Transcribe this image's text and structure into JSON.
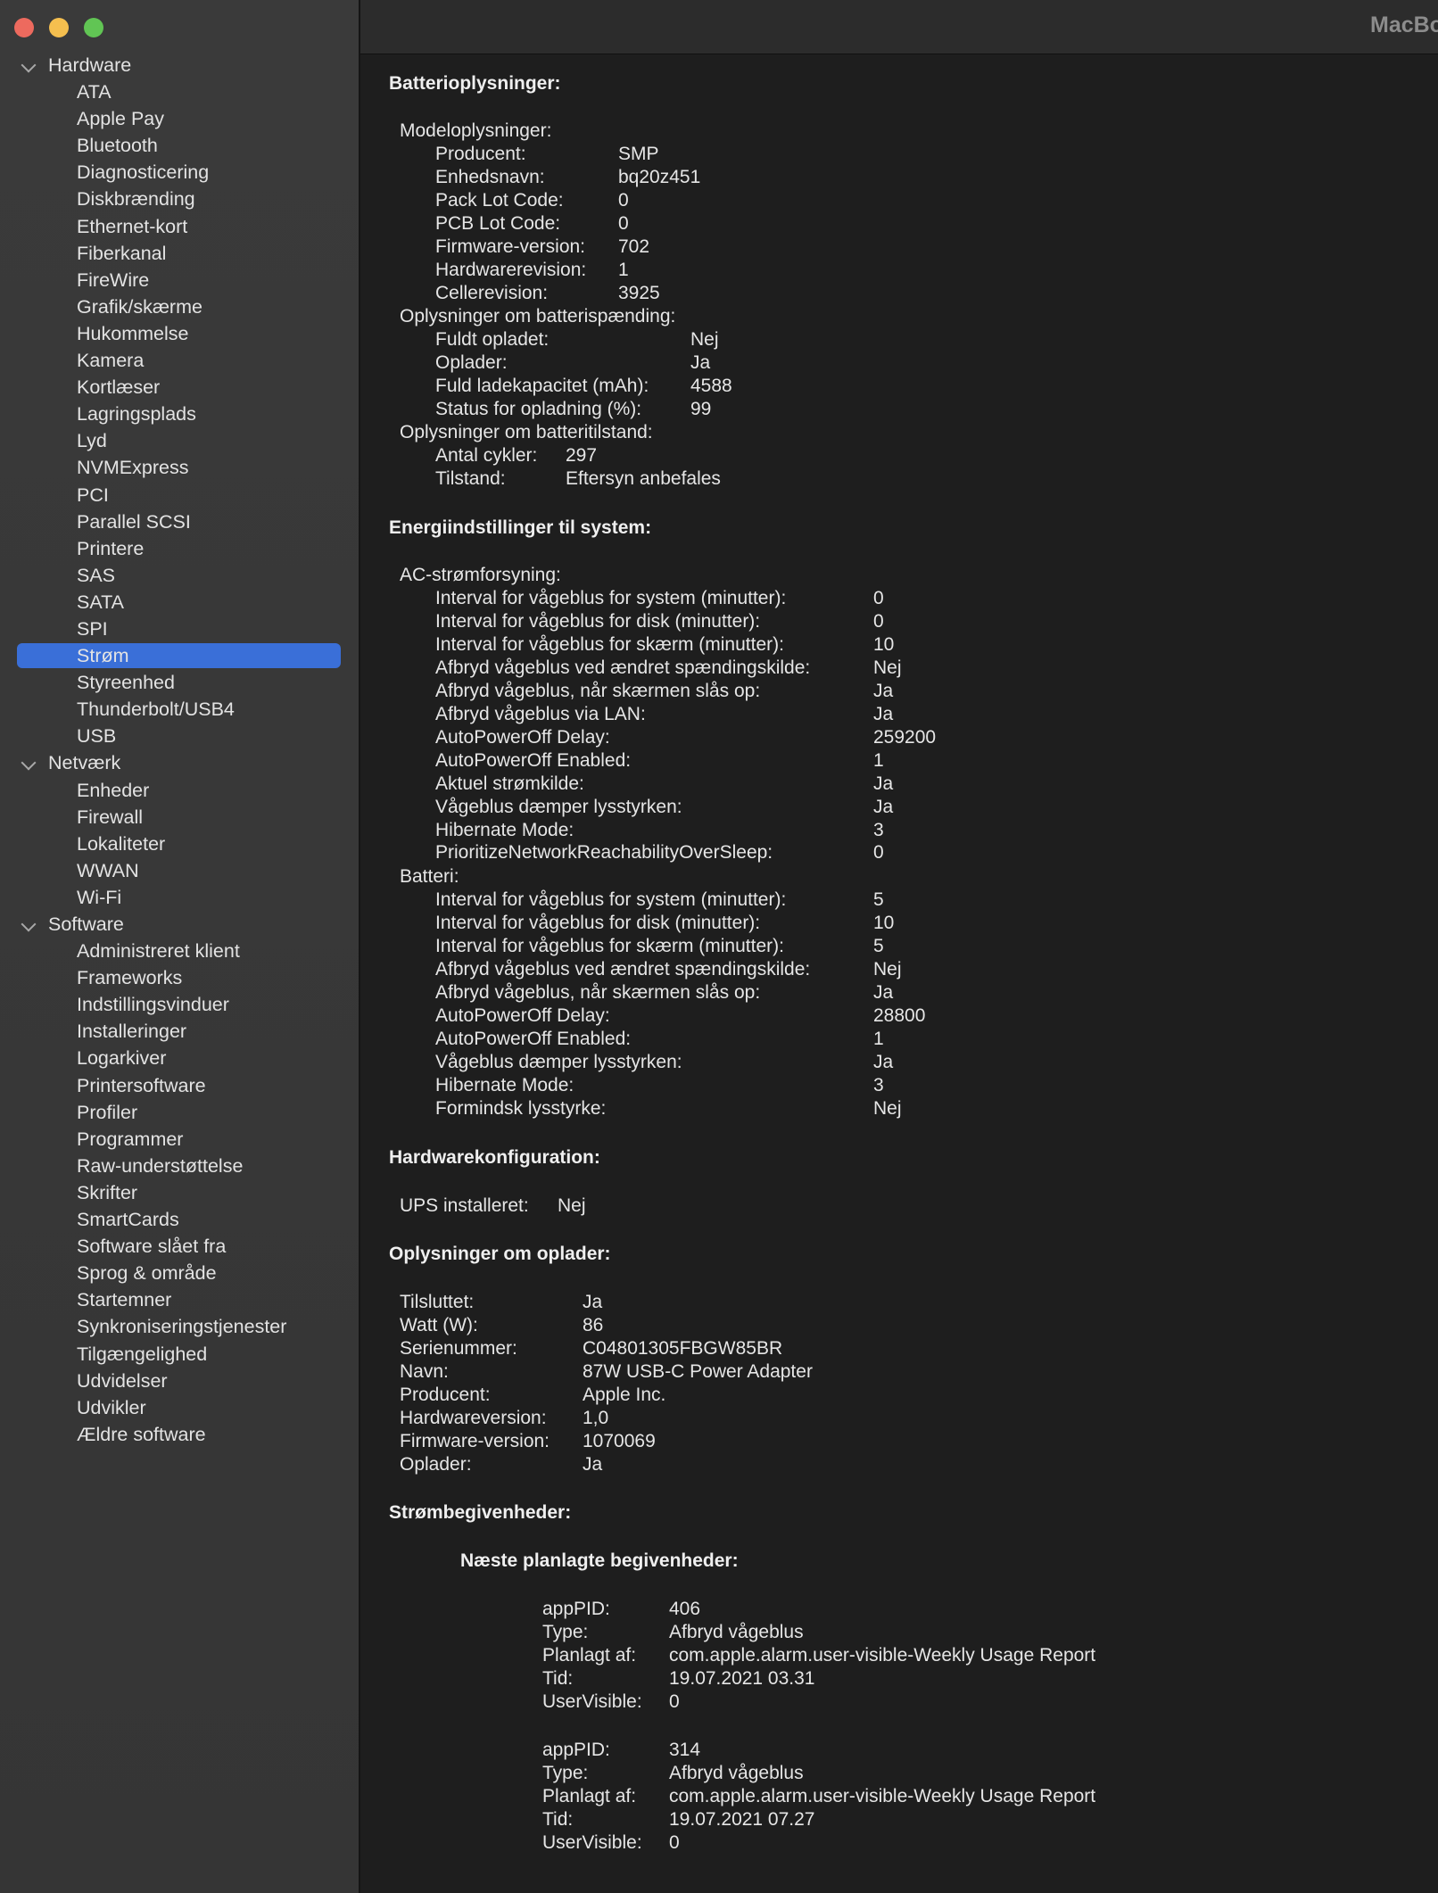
{
  "window": {
    "title": "MacBo"
  },
  "sidebar": {
    "items": [
      {
        "label": "Hardware",
        "type": "group"
      },
      {
        "label": "ATA",
        "type": "leaf"
      },
      {
        "label": "Apple Pay",
        "type": "leaf"
      },
      {
        "label": "Bluetooth",
        "type": "leaf"
      },
      {
        "label": "Diagnosticering",
        "type": "leaf"
      },
      {
        "label": "Diskbrænding",
        "type": "leaf"
      },
      {
        "label": "Ethernet-kort",
        "type": "leaf"
      },
      {
        "label": "Fiberkanal",
        "type": "leaf"
      },
      {
        "label": "FireWire",
        "type": "leaf"
      },
      {
        "label": "Grafik/skærme",
        "type": "leaf"
      },
      {
        "label": "Hukommelse",
        "type": "leaf"
      },
      {
        "label": "Kamera",
        "type": "leaf"
      },
      {
        "label": "Kortlæser",
        "type": "leaf"
      },
      {
        "label": "Lagringsplads",
        "type": "leaf"
      },
      {
        "label": "Lyd",
        "type": "leaf"
      },
      {
        "label": "NVMExpress",
        "type": "leaf"
      },
      {
        "label": "PCI",
        "type": "leaf"
      },
      {
        "label": "Parallel SCSI",
        "type": "leaf"
      },
      {
        "label": "Printere",
        "type": "leaf"
      },
      {
        "label": "SAS",
        "type": "leaf"
      },
      {
        "label": "SATA",
        "type": "leaf"
      },
      {
        "label": "SPI",
        "type": "leaf"
      },
      {
        "label": "Strøm",
        "type": "leaf",
        "selected": true
      },
      {
        "label": "Styreenhed",
        "type": "leaf"
      },
      {
        "label": "Thunderbolt/USB4",
        "type": "leaf"
      },
      {
        "label": "USB",
        "type": "leaf"
      },
      {
        "label": "Netværk",
        "type": "group"
      },
      {
        "label": "Enheder",
        "type": "leaf"
      },
      {
        "label": "Firewall",
        "type": "leaf"
      },
      {
        "label": "Lokaliteter",
        "type": "leaf"
      },
      {
        "label": "WWAN",
        "type": "leaf"
      },
      {
        "label": "Wi-Fi",
        "type": "leaf"
      },
      {
        "label": "Software",
        "type": "group"
      },
      {
        "label": "Administreret klient",
        "type": "leaf"
      },
      {
        "label": "Frameworks",
        "type": "leaf"
      },
      {
        "label": "Indstillingsvinduer",
        "type": "leaf"
      },
      {
        "label": "Installeringer",
        "type": "leaf"
      },
      {
        "label": "Logarkiver",
        "type": "leaf"
      },
      {
        "label": "Printersoftware",
        "type": "leaf"
      },
      {
        "label": "Profiler",
        "type": "leaf"
      },
      {
        "label": "Programmer",
        "type": "leaf"
      },
      {
        "label": "Raw-understøttelse",
        "type": "leaf"
      },
      {
        "label": "Skrifter",
        "type": "leaf"
      },
      {
        "label": "SmartCards",
        "type": "leaf"
      },
      {
        "label": "Software slået fra",
        "type": "leaf"
      },
      {
        "label": "Sprog & område",
        "type": "leaf"
      },
      {
        "label": "Startemner",
        "type": "leaf"
      },
      {
        "label": "Synkroniseringstjenester",
        "type": "leaf"
      },
      {
        "label": "Tilgængelighed",
        "type": "leaf"
      },
      {
        "label": "Udvidelser",
        "type": "leaf"
      },
      {
        "label": "Udvikler",
        "type": "leaf"
      },
      {
        "label": "Ældre software",
        "type": "leaf"
      }
    ]
  },
  "battery": {
    "heading": "Batterioplysninger:",
    "model_heading": "Modeloplysninger:",
    "model": [
      {
        "k": "Producent:",
        "v": "SMP"
      },
      {
        "k": "Enhedsnavn:",
        "v": "bq20z451"
      },
      {
        "k": "Pack Lot Code:",
        "v": "0"
      },
      {
        "k": "PCB Lot Code:",
        "v": "0"
      },
      {
        "k": "Firmware-version:",
        "v": "702"
      },
      {
        "k": "Hardwarerevision:",
        "v": "1"
      },
      {
        "k": "Cellerevision:",
        "v": "3925"
      }
    ],
    "charge_heading": "Oplysninger om batterispænding:",
    "charge": [
      {
        "k": "Fuldt opladet:",
        "v": "Nej"
      },
      {
        "k": "Oplader:",
        "v": "Ja"
      },
      {
        "k": "Fuld ladekapacitet (mAh):",
        "v": "4588"
      },
      {
        "k": "Status for opladning (%):",
        "v": "99"
      }
    ],
    "health_heading": "Oplysninger om batteritilstand:",
    "health": [
      {
        "k": "Antal cykler:",
        "v": "297"
      },
      {
        "k": "Tilstand:",
        "v": "Eftersyn anbefales"
      }
    ]
  },
  "energy": {
    "heading": "Energiindstillinger til system:",
    "ac_heading": "AC-strømforsyning:",
    "ac": [
      {
        "k": "Interval for vågeblus for system (minutter):",
        "v": "0"
      },
      {
        "k": "Interval for vågeblus for disk (minutter):",
        "v": "0"
      },
      {
        "k": "Interval for vågeblus for skærm (minutter):",
        "v": "10"
      },
      {
        "k": "Afbryd vågeblus ved ændret spændingskilde:",
        "v": "Nej"
      },
      {
        "k": "Afbryd vågeblus, når skærmen slås op:",
        "v": "Ja"
      },
      {
        "k": "Afbryd vågeblus via LAN:",
        "v": "Ja"
      },
      {
        "k": "AutoPowerOff Delay:",
        "v": "259200"
      },
      {
        "k": "AutoPowerOff Enabled:",
        "v": "1"
      },
      {
        "k": "Aktuel strømkilde:",
        "v": "Ja"
      },
      {
        "k": "Vågeblus dæmper lysstyrken:",
        "v": "Ja"
      },
      {
        "k": "Hibernate Mode:",
        "v": "3"
      },
      {
        "k": "PrioritizeNetworkReachabilityOverSleep:",
        "v": "0"
      }
    ],
    "bat_heading": "Batteri:",
    "bat": [
      {
        "k": "Interval for vågeblus for system (minutter):",
        "v": "5"
      },
      {
        "k": "Interval for vågeblus for disk (minutter):",
        "v": "10"
      },
      {
        "k": "Interval for vågeblus for skærm (minutter):",
        "v": "5"
      },
      {
        "k": "Afbryd vågeblus ved ændret spændingskilde:",
        "v": "Nej"
      },
      {
        "k": "Afbryd vågeblus, når skærmen slås op:",
        "v": "Ja"
      },
      {
        "k": "AutoPowerOff Delay:",
        "v": "28800"
      },
      {
        "k": "AutoPowerOff Enabled:",
        "v": "1"
      },
      {
        "k": "Vågeblus dæmper lysstyrken:",
        "v": "Ja"
      },
      {
        "k": "Hibernate Mode:",
        "v": "3"
      },
      {
        "k": "Formindsk lysstyrke:",
        "v": "Nej"
      }
    ]
  },
  "hwconfig": {
    "heading": "Hardwarekonfiguration:",
    "rows": [
      {
        "k": "UPS installeret:",
        "v": "Nej"
      }
    ]
  },
  "charger": {
    "heading": "Oplysninger om oplader:",
    "rows": [
      {
        "k": "Tilsluttet:",
        "v": "Ja"
      },
      {
        "k": "Watt (W):",
        "v": "86"
      },
      {
        "k": "Serienummer:",
        "v": "C04801305FBGW85BR"
      },
      {
        "k": "Navn:",
        "v": "87W USB-C Power Adapter"
      },
      {
        "k": "Producent:",
        "v": "Apple Inc."
      },
      {
        "k": "Hardwareversion:",
        "v": "1,0"
      },
      {
        "k": "Firmware-version:",
        "v": "1070069"
      },
      {
        "k": "Oplader:",
        "v": "Ja"
      }
    ]
  },
  "events": {
    "heading": "Strømbegivenheder:",
    "sub_heading": "Næste planlagte begivenheder:",
    "items": [
      [
        {
          "k": "appPID:",
          "v": "406"
        },
        {
          "k": "Type:",
          "v": "Afbryd vågeblus"
        },
        {
          "k": "Planlagt af:",
          "v": "com.apple.alarm.user-visible-Weekly Usage Report"
        },
        {
          "k": "Tid:",
          "v": "19.07.2021 03.31"
        },
        {
          "k": "UserVisible:",
          "v": "0"
        }
      ],
      [
        {
          "k": "appPID:",
          "v": "314"
        },
        {
          "k": "Type:",
          "v": "Afbryd vågeblus"
        },
        {
          "k": "Planlagt af:",
          "v": "com.apple.alarm.user-visible-Weekly Usage Report"
        },
        {
          "k": "Tid:",
          "v": "19.07.2021 07.27"
        },
        {
          "k": "UserVisible:",
          "v": "0"
        }
      ]
    ]
  }
}
